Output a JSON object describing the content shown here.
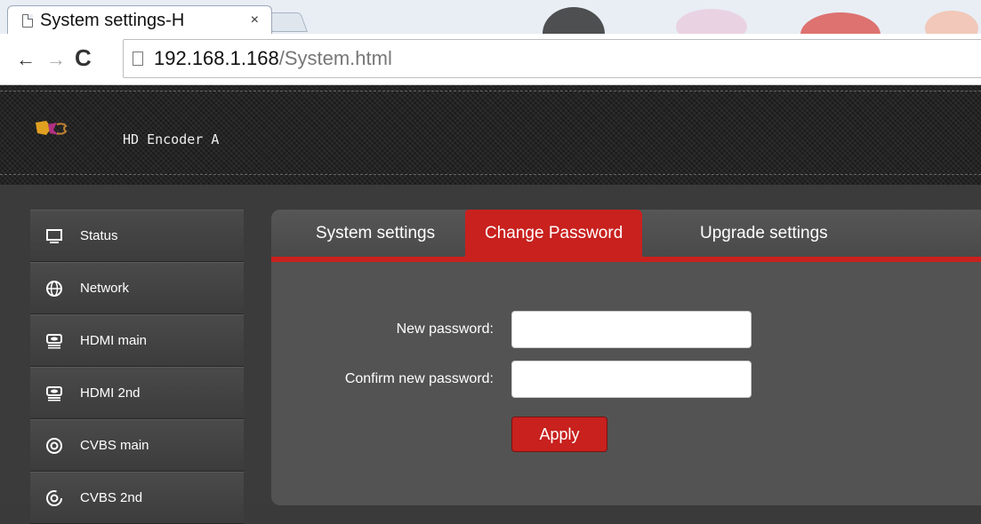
{
  "browser": {
    "tab_title": "System settings-H",
    "tab_close": "×",
    "url_host": "192.168.1.168",
    "url_path": "/System.html",
    "back": "←",
    "forward": "→",
    "reload": "C"
  },
  "header": {
    "device_name": "HD Encoder  A"
  },
  "sidebar": {
    "items": [
      {
        "label": "Status",
        "icon": "monitor-icon"
      },
      {
        "label": "Network",
        "icon": "globe-icon"
      },
      {
        "label": "HDMI main",
        "icon": "hdmi-icon"
      },
      {
        "label": "HDMI 2nd",
        "icon": "hdmi-icon"
      },
      {
        "label": "CVBS main",
        "icon": "cvbs-icon"
      },
      {
        "label": "CVBS 2nd",
        "icon": "cvbs-icon"
      }
    ]
  },
  "panel": {
    "tabs": [
      {
        "label": "System settings",
        "active": false
      },
      {
        "label": "Change Password",
        "active": true
      },
      {
        "label": "Upgrade settings",
        "active": false
      }
    ],
    "new_password_label": "New password:",
    "confirm_password_label": "Confirm new password:",
    "new_password_value": "",
    "confirm_password_value": "",
    "apply_label": "Apply"
  },
  "colors": {
    "accent": "#c8211e",
    "panel_bg": "#535353",
    "page_bg": "#3b3b3b"
  }
}
